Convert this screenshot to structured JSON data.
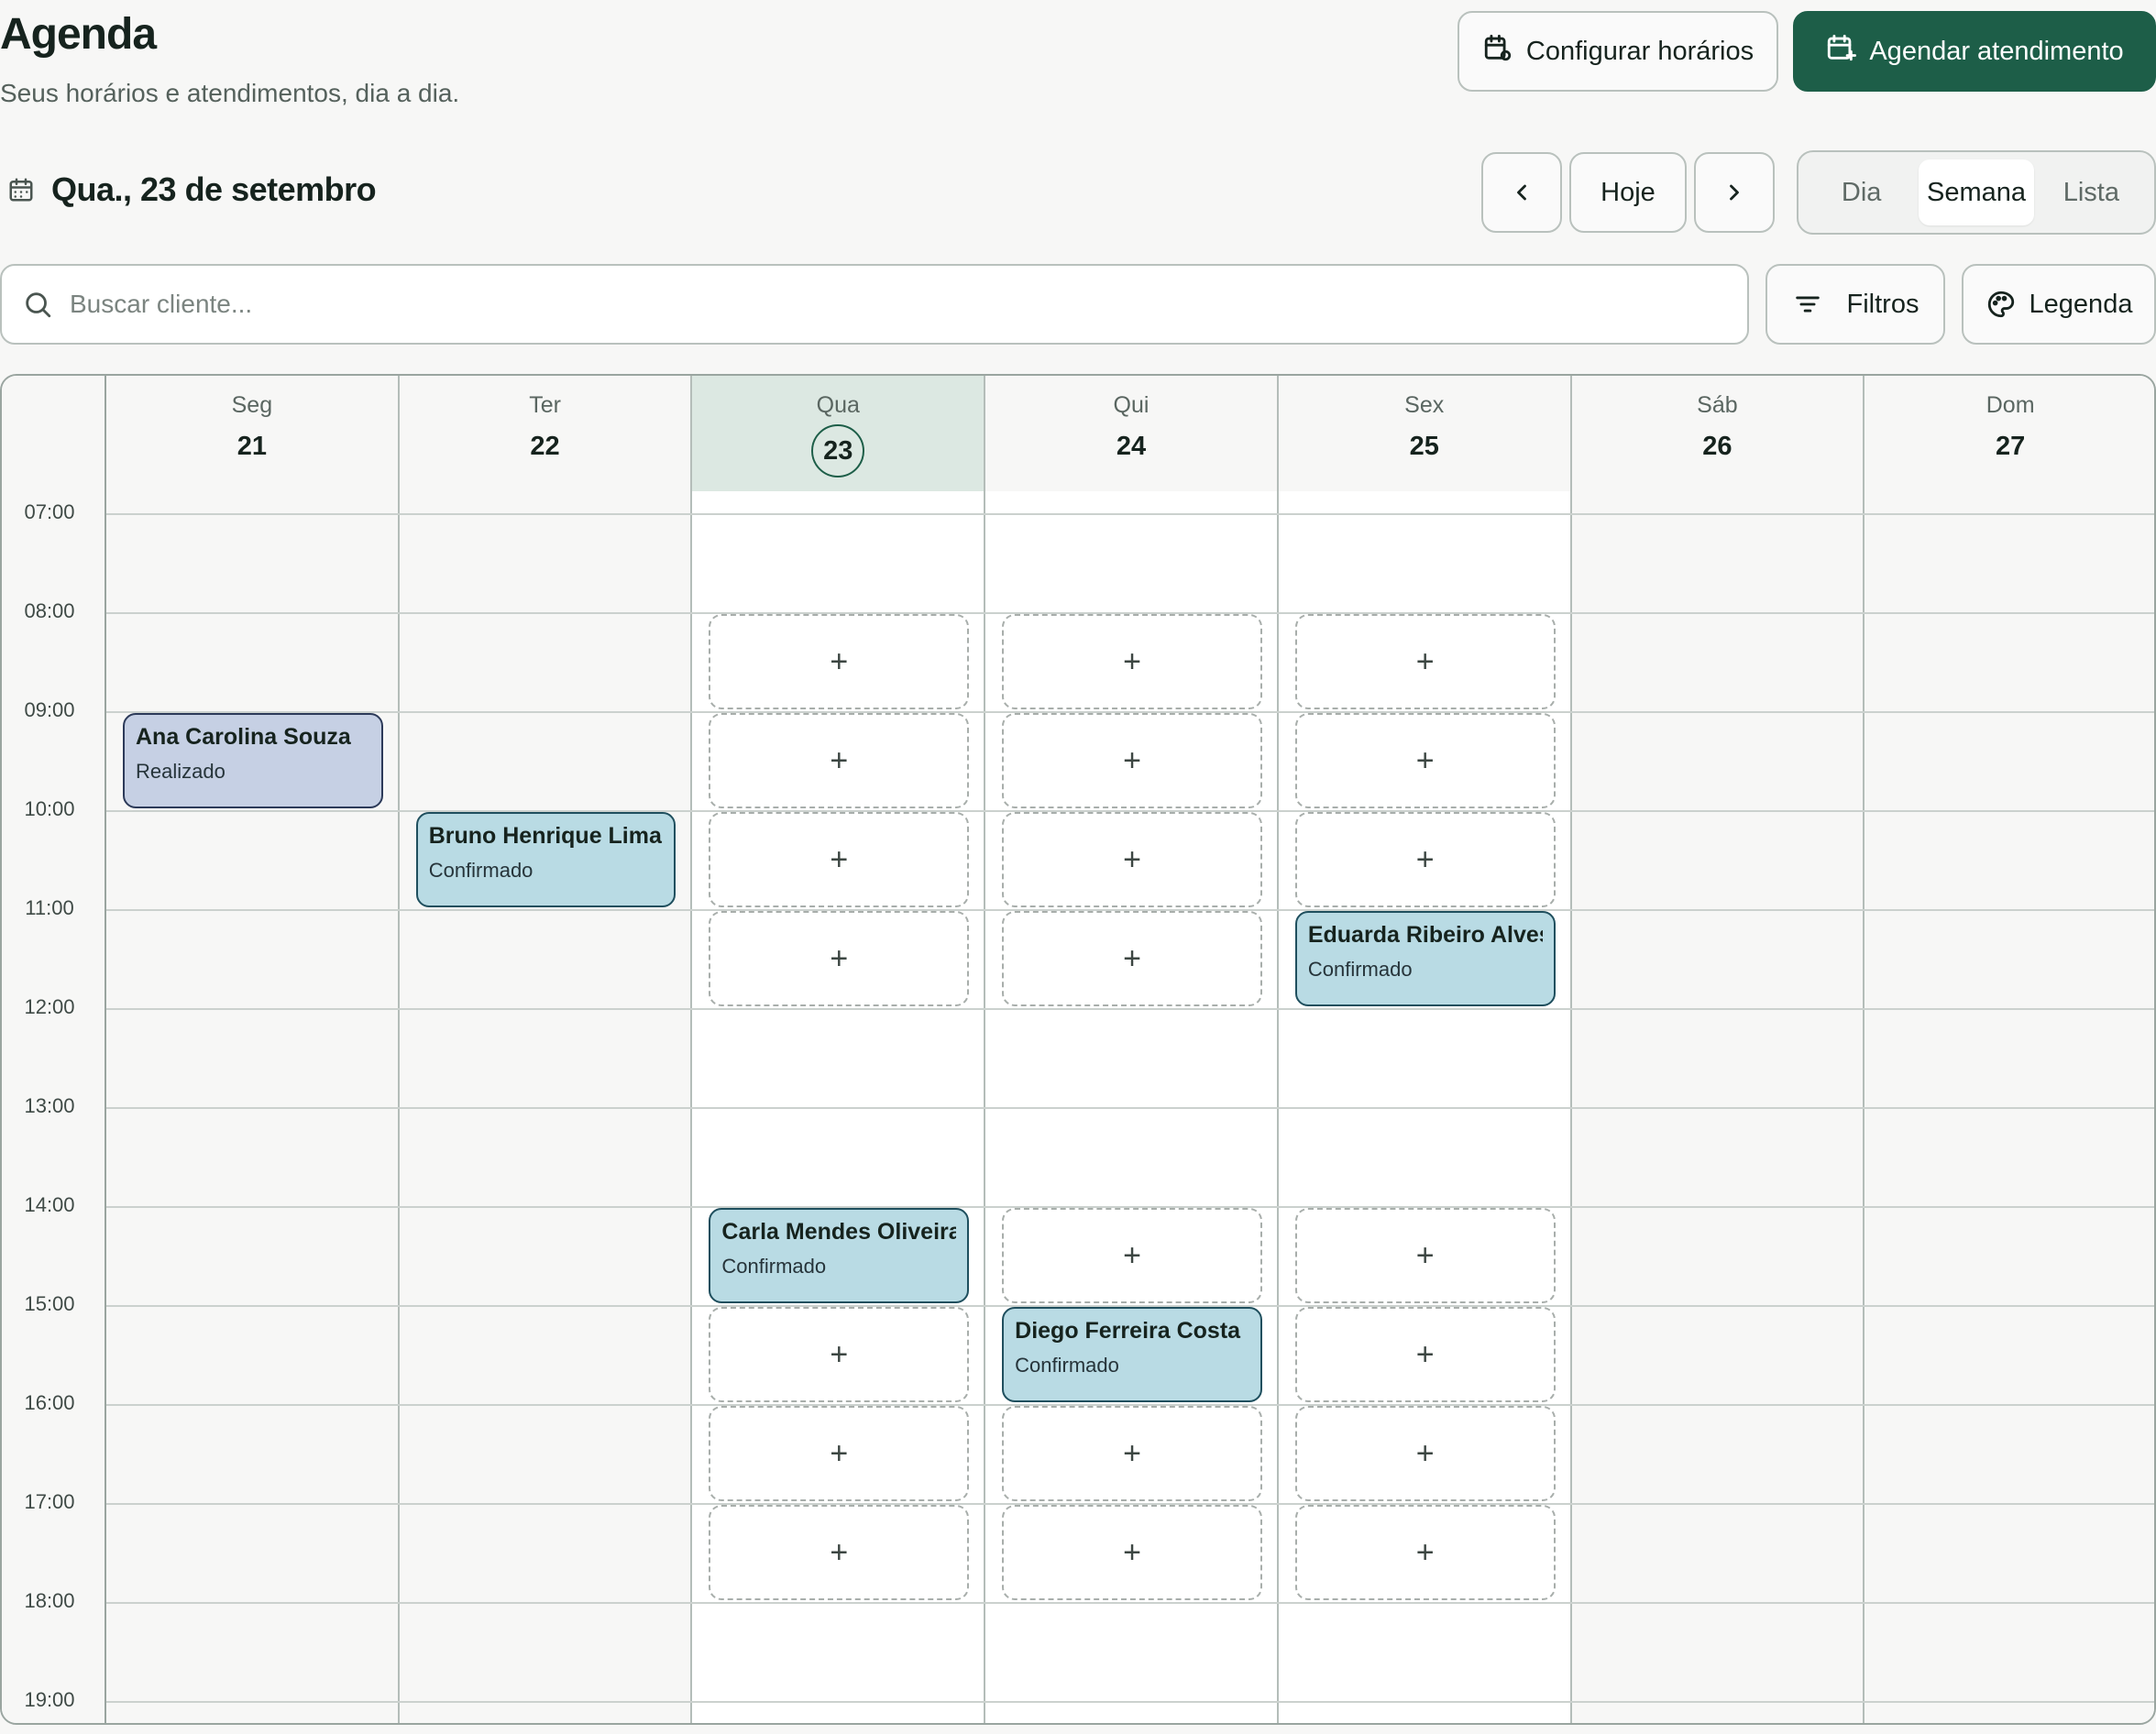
{
  "header": {
    "title": "Agenda",
    "subtitle": "Seus horários e atendimentos, dia a dia.",
    "configure_label": "Configurar horários",
    "schedule_label": "Agendar atendimento"
  },
  "toolbar": {
    "current_date": "Qua., 23 de setembro",
    "today_label": "Hoje",
    "views": [
      "Dia",
      "Semana",
      "Lista"
    ],
    "active_view": "Semana"
  },
  "search": {
    "placeholder": "Buscar cliente...",
    "value": ""
  },
  "filters_label": "Filtros",
  "legend_label": "Legenda",
  "calendar": {
    "days": [
      {
        "name": "Seg",
        "num": "21"
      },
      {
        "name": "Ter",
        "num": "22"
      },
      {
        "name": "Qua",
        "num": "23"
      },
      {
        "name": "Qui",
        "num": "24"
      },
      {
        "name": "Sex",
        "num": "25"
      },
      {
        "name": "Sáb",
        "num": "26"
      },
      {
        "name": "Dom",
        "num": "27"
      }
    ],
    "today_index": 2,
    "hours": [
      "07:00",
      "08:00",
      "09:00",
      "10:00",
      "11:00",
      "12:00",
      "13:00",
      "14:00",
      "15:00",
      "16:00",
      "17:00",
      "18:00",
      "19:00"
    ],
    "available_slot_glyph": "+",
    "available_slots": [
      {
        "day": 2,
        "start": "08:00"
      },
      {
        "day": 2,
        "start": "09:00"
      },
      {
        "day": 2,
        "start": "10:00"
      },
      {
        "day": 2,
        "start": "11:00"
      },
      {
        "day": 2,
        "start": "15:00"
      },
      {
        "day": 2,
        "start": "16:00"
      },
      {
        "day": 2,
        "start": "17:00"
      },
      {
        "day": 3,
        "start": "08:00"
      },
      {
        "day": 3,
        "start": "09:00"
      },
      {
        "day": 3,
        "start": "10:00"
      },
      {
        "day": 3,
        "start": "11:00"
      },
      {
        "day": 3,
        "start": "14:00"
      },
      {
        "day": 3,
        "start": "16:00"
      },
      {
        "day": 3,
        "start": "17:00"
      },
      {
        "day": 4,
        "start": "08:00"
      },
      {
        "day": 4,
        "start": "09:00"
      },
      {
        "day": 4,
        "start": "10:00"
      },
      {
        "day": 4,
        "start": "14:00"
      },
      {
        "day": 4,
        "start": "15:00"
      },
      {
        "day": 4,
        "start": "16:00"
      },
      {
        "day": 4,
        "start": "17:00"
      }
    ],
    "appointments": [
      {
        "day": 0,
        "start": "09:00",
        "name": "Ana Carolina Souza",
        "status": "Realizado",
        "color": "#c6d0e4"
      },
      {
        "day": 1,
        "start": "10:00",
        "name": "Bruno Henrique Lima",
        "status": "Confirmado",
        "color": "#b9dbe4"
      },
      {
        "day": 2,
        "start": "14:00",
        "name": "Carla Mendes Oliveira",
        "status": "Confirmado",
        "color": "#b9dbe4"
      },
      {
        "day": 3,
        "start": "15:00",
        "name": "Diego Ferreira Costa",
        "status": "Confirmado",
        "color": "#b9dbe4"
      },
      {
        "day": 4,
        "start": "11:00",
        "name": "Eduarda Ribeiro Alves",
        "status": "Confirmado",
        "color": "#b9dbe4"
      }
    ]
  },
  "colors": {
    "primary": "#1d5e48",
    "today_column": "#dce8e2",
    "confirmed": "#b9dbe4",
    "done": "#c6d0e4"
  }
}
